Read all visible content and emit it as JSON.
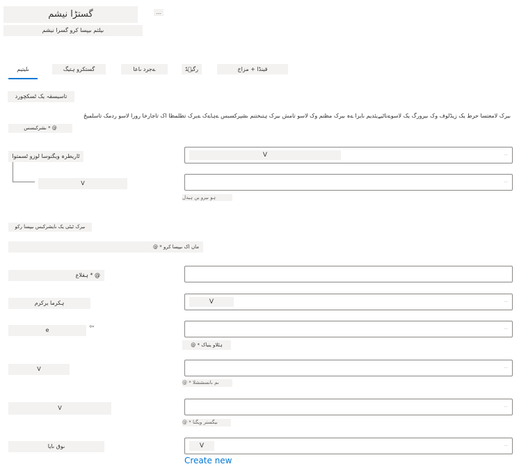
{
  "header": {
    "title": "گستڑا نیشم",
    "subtitle": "ںیلثم ںیپسا کرو گسرا نیشم",
    "more_label": "..."
  },
  "tabs": [
    {
      "label": "ںلیتیم",
      "active": true
    },
    {
      "label": "گستکرو ہتیگ"
    },
    {
      "label": "ےجرد ںاعا"
    },
    {
      "label": "رگی٘ڈ"
    },
    {
      "label": "قینڈا + مزاج"
    }
  ],
  "section_title": "تاسیسقہ یک ٹسکچورد",
  "description": "ںیرک لامعتسا حرط یک زیڈلوف وک ںیرورگ یک لاسوےناٹیےیئدیم ںایرا ےہ ںیرک مظنم وک لاسو تامش ںیرک ہتبختنم ںشپرکسبس ےہاےک ےیرک تطلمظا اک تاجارخا رورا لاسو ردمک تاسلمیحٰ",
  "subscription_label": "ںشرکبسس * @",
  "fields": {
    "subscription": {
      "label": "ٹاریطرہ ویگنوسا لوزو ٹسمتوا",
      "value": "V",
      "suffix": "..."
    },
    "resource_group": {
      "label": "V",
      "suffix": "...",
      "hint": "ہو ںیرو یں ہیدل"
    },
    "instance_heading": "ںیرک ٹیٹی یک ںایشرکبس ںیپسا رکو",
    "instance_name_label": "@ * ماں اک ںیپسا کرو",
    "region": {
      "label": "ہقلاع * @",
      "suffix": ""
    },
    "type": {
      "label": "ہکرما یرکرم",
      "value": "V",
      "suffix": "..."
    },
    "size": {
      "label": "e",
      "suffix": "...",
      "side_icon": "⇦"
    },
    "auth_label": "@ * ہٹلاو ینیاک",
    "username": {
      "label": "V",
      "suffix": "...",
      "hint": "@ * ںم ںانسششلا"
    },
    "password": {
      "label": "V",
      "suffix": "...",
      "hint": "@ * ںیگستر ویگنا"
    },
    "network": {
      "label": "ںوق ںایا",
      "value": "V",
      "suffix": "..."
    }
  },
  "create_new_label": "Create new"
}
